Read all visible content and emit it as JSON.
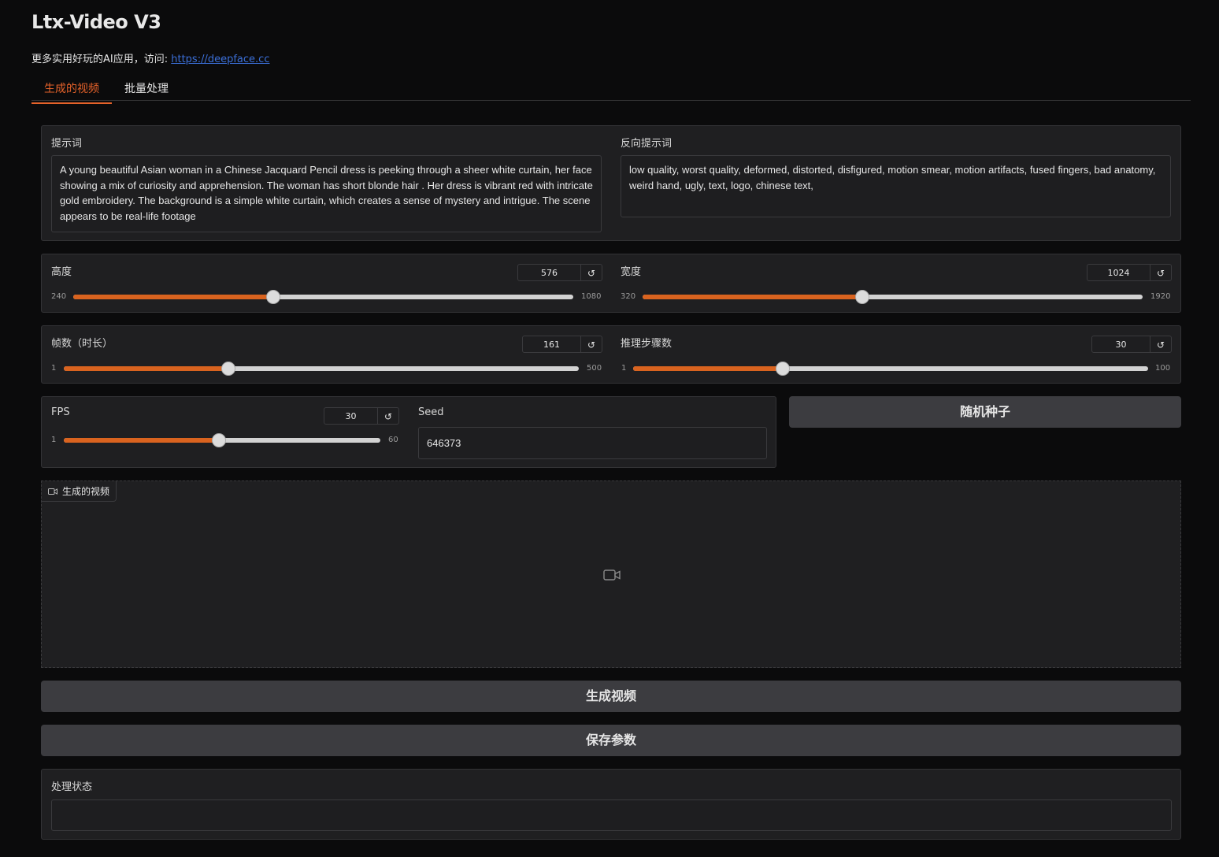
{
  "header": {
    "title": "Ltx-Video V3",
    "subtitle_text": "更多实用好玩的AI应用，访问: ",
    "subtitle_link": "https://deepface.cc"
  },
  "tabs": [
    {
      "label": "生成的视频",
      "active": true
    },
    {
      "label": "批量处理",
      "active": false
    }
  ],
  "prompt": {
    "label": "提示词",
    "value": "A young beautiful Asian woman in a Chinese Jacquard Pencil dress is peeking through a sheer white curtain, her face showing a mix of curiosity and apprehension. The woman has short blonde hair . Her dress is vibrant red with intricate gold embroidery. The background is a simple white curtain, which creates a sense of mystery and intrigue. The scene appears to be real-life footage"
  },
  "negative_prompt": {
    "label": "反向提示词",
    "value": "low quality, worst quality, deformed, distorted, disfigured, motion smear, motion artifacts, fused fingers, bad anatomy, weird hand, ugly, text, logo, chinese text,"
  },
  "sliders": {
    "height": {
      "label": "高度",
      "value": "576",
      "min": "240",
      "max": "1080",
      "fraction": 0.4
    },
    "width": {
      "label": "宽度",
      "value": "1024",
      "min": "320",
      "max": "1920",
      "fraction": 0.44
    },
    "frames": {
      "label": "帧数（时长）",
      "value": "161",
      "min": "1",
      "max": "500",
      "fraction": 0.32
    },
    "steps": {
      "label": "推理步骤数",
      "value": "30",
      "min": "1",
      "max": "100",
      "fraction": 0.29
    },
    "fps": {
      "label": "FPS",
      "value": "30",
      "min": "1",
      "max": "60",
      "fraction": 0.49
    }
  },
  "reset_icon_glyph": "↺",
  "seed": {
    "label": "Seed",
    "value": "646373"
  },
  "buttons": {
    "random_seed": "随机种子",
    "generate": "生成视频",
    "save_params": "保存参数"
  },
  "video": {
    "tag_label": "生成的视频"
  },
  "status": {
    "label": "处理状态",
    "value": ""
  },
  "colors": {
    "accent": "#e5622a",
    "slider_fill": "#d9631f",
    "background": "#0b0b0c",
    "panel": "#1f1f21",
    "button": "#3c3c40",
    "link": "#3b6fd8"
  }
}
